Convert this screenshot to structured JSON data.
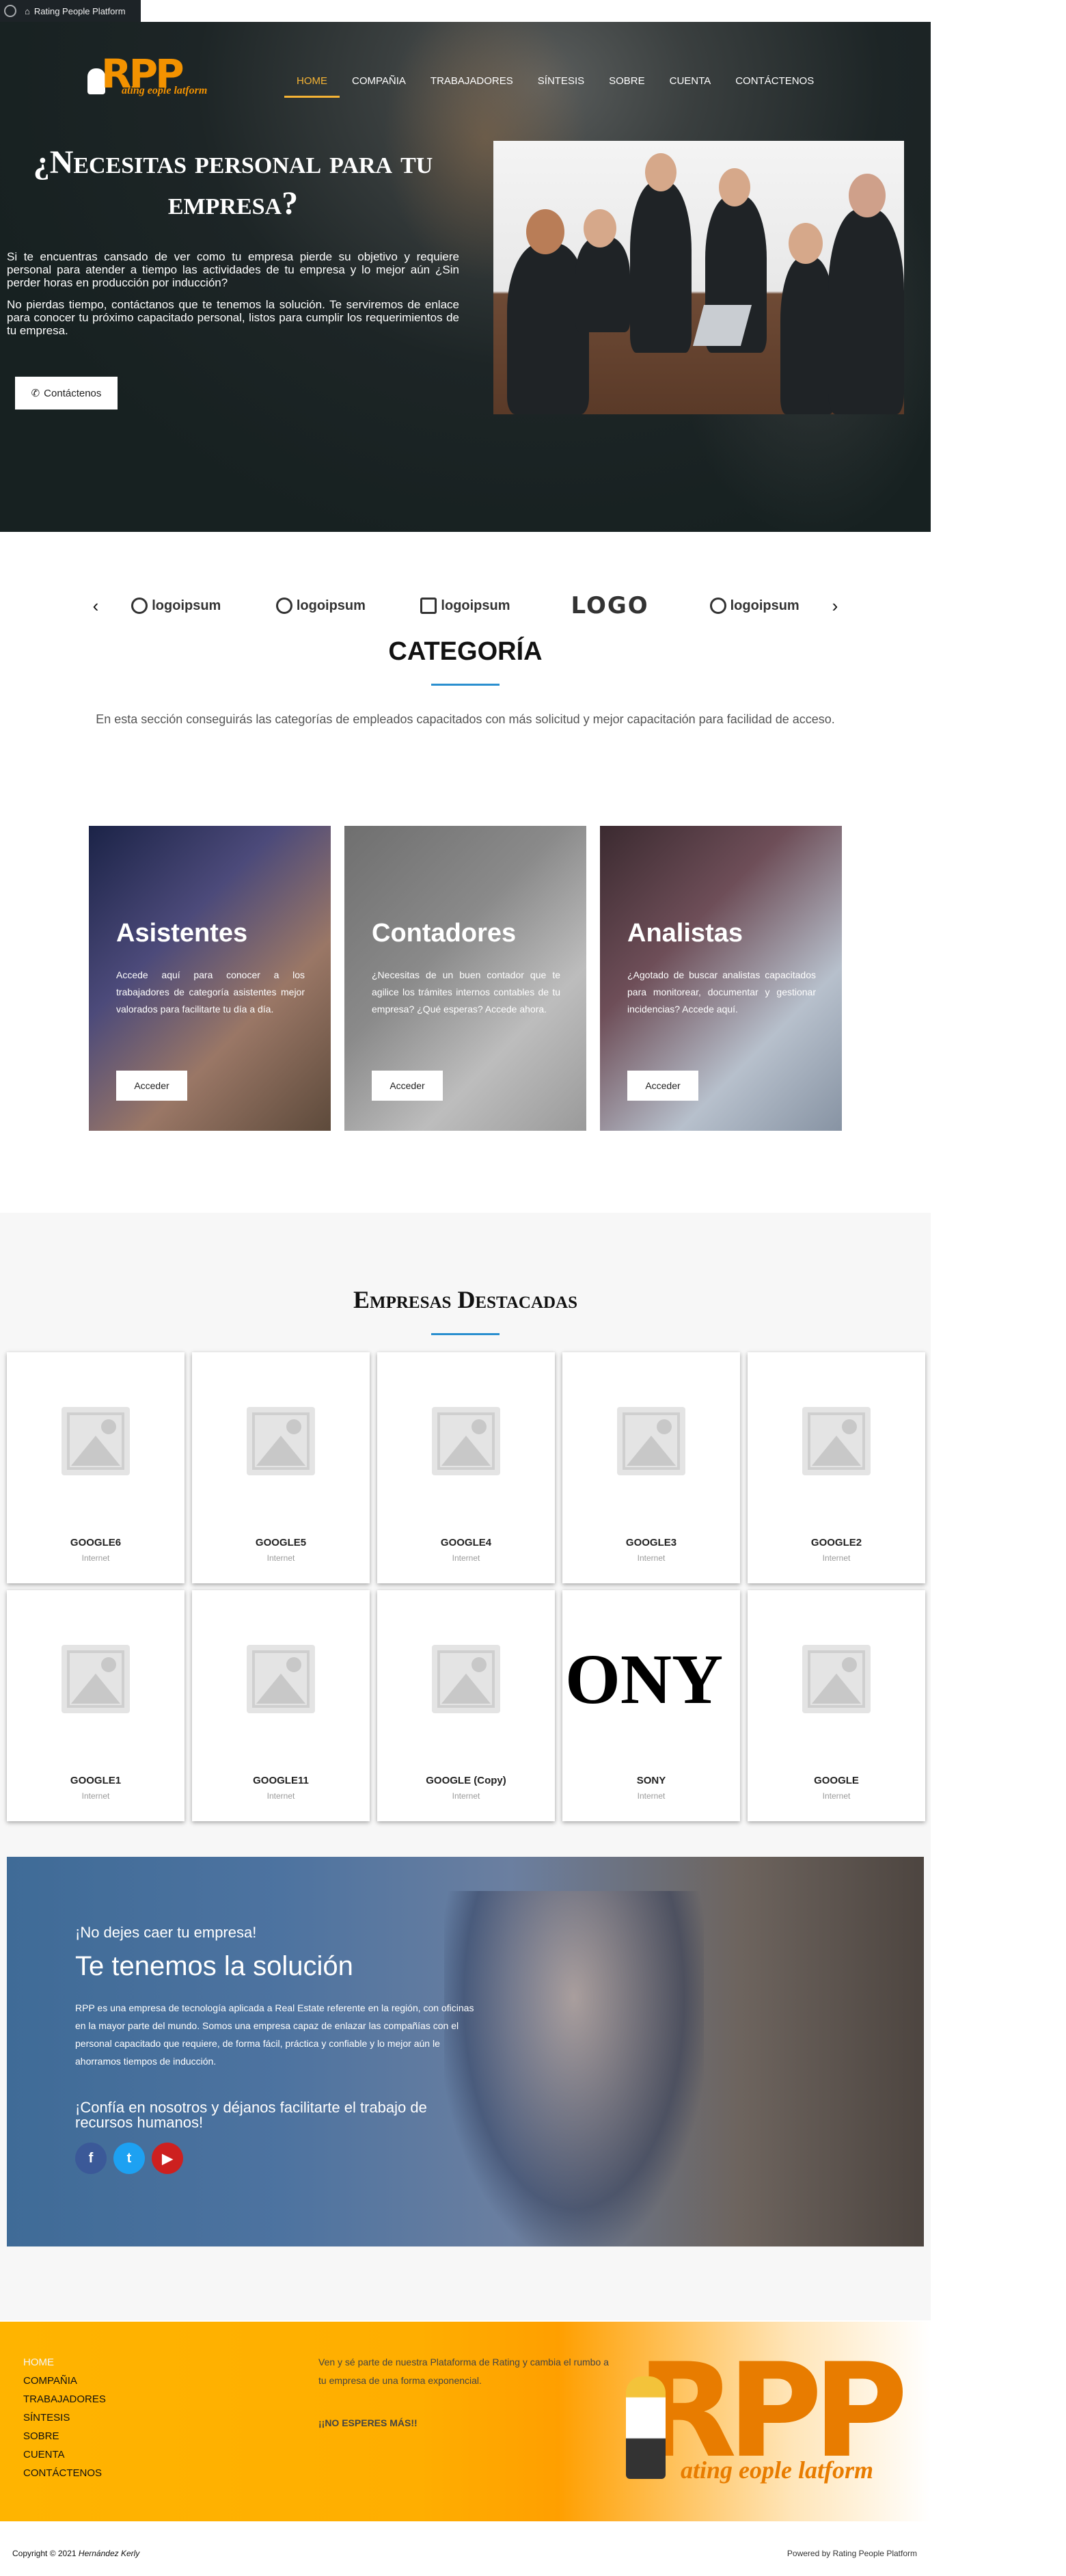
{
  "admin_bar": {
    "site_name": "Rating People Platform"
  },
  "header": {
    "logo": {
      "big": "RPP",
      "small": "ating eople latform"
    },
    "nav": [
      {
        "label": "HOME",
        "active": true
      },
      {
        "label": "COMPAÑIA",
        "active": false
      },
      {
        "label": "TRABAJADORES",
        "active": false
      },
      {
        "label": "SÍNTESIS",
        "active": false
      },
      {
        "label": "SOBRE",
        "active": false
      },
      {
        "label": "CUENTA",
        "active": false
      },
      {
        "label": "CONTÁCTENOS",
        "active": false
      }
    ]
  },
  "hero": {
    "title": "¿Necesitas personal para tu empresa?",
    "paragraph1": "Si te encuentras cansado de ver como tu empresa pierde su objetivo y requiere personal para atender a tiempo las actividades de tu empresa y lo mejor aún ¿Sin perder horas en producción por inducción?",
    "paragraph2": "No pierdas tiempo, contáctanos que te tenemos la solución. Te serviremos de enlace para conocer tu próximo capacitado personal, listos para cumplir los requerimientos de tu empresa.",
    "button_label": "Contáctenos"
  },
  "logos": [
    "logoipsum",
    "logoipsum",
    "logoipsum",
    "LOGO",
    "logoipsum"
  ],
  "category": {
    "title": "CATEGORÍA",
    "description": "En esta sección conseguirás las categorías de empleados capacitados con más solicitud y mejor capacitación para facilidad de acceso.",
    "cards": [
      {
        "title": "Asistentes",
        "text": "Accede aquí para conocer a los trabajadores de categoría asistentes mejor valorados para facilitarte tu día a día.",
        "button": "Acceder"
      },
      {
        "title": "Contadores",
        "text": "¿Necesitas de un buen contador que te agilice los trámites internos contables de tu empresa? ¿Qué esperas? Accede ahora.",
        "button": "Acceder"
      },
      {
        "title": "Analistas",
        "text": "¿Agotado de buscar analistas capacitados para monitorear, documentar y gestionar incidencias? Accede aquí.",
        "button": "Acceder"
      }
    ]
  },
  "featured": {
    "title": "Empresas Destacadas",
    "companies": [
      {
        "name": "GOOGLE6",
        "category": "Internet",
        "image": "placeholder"
      },
      {
        "name": "GOOGLE5",
        "category": "Internet",
        "image": "placeholder"
      },
      {
        "name": "GOOGLE4",
        "category": "Internet",
        "image": "placeholder"
      },
      {
        "name": "GOOGLE3",
        "category": "Internet",
        "image": "placeholder"
      },
      {
        "name": "GOOGLE2",
        "category": "Internet",
        "image": "placeholder"
      },
      {
        "name": "GOOGLE1",
        "category": "Internet",
        "image": "placeholder"
      },
      {
        "name": "GOOGLE11",
        "category": "Internet",
        "image": "placeholder"
      },
      {
        "name": "GOOGLE (Copy)",
        "category": "Internet",
        "image": "placeholder"
      },
      {
        "name": "SONY",
        "category": "Internet",
        "image": "sony-logo",
        "logo_text": "ONY"
      },
      {
        "name": "GOOGLE",
        "category": "Internet",
        "image": "placeholder"
      }
    ]
  },
  "banner": {
    "kicker": "¡No dejes caer tu empresa!",
    "title": "Te tenemos la solución",
    "text": "RPP es una empresa de tecnología aplicada a Real Estate referente en la región, con oficinas en la mayor parte del mundo. Somos una empresa capaz de enlazar las compañías con el personal capacitado que requiere, de forma fácil, práctica y confiable y lo mejor aún le ahorramos tiempos de inducción.",
    "cta": "¡Confía en nosotros y déjanos facilitarte el trabajo de recursos humanos!",
    "socials": [
      {
        "icon": "facebook-icon",
        "glyph": "f",
        "color": "#3b5998"
      },
      {
        "icon": "twitter-icon",
        "glyph": "t",
        "color": "#1da1f2"
      },
      {
        "icon": "youtube-icon",
        "glyph": "▶",
        "color": "#cd201f"
      }
    ]
  },
  "footer": {
    "nav": [
      "HOME",
      "COMPAÑIA",
      "TRABAJADORES",
      "SÍNTESIS",
      "SOBRE",
      "CUENTA",
      "CONTÁCTENOS"
    ],
    "text": "Ven y sé parte de nuestra Plataforma de Rating y cambia el rumbo a tu empresa de una forma exponencial.",
    "cta": "¡¡NO ESPERES MÁS!!",
    "logo": {
      "big": "RPP",
      "small": "ating eople latform"
    },
    "copyright_prefix": "Copyright © 2021",
    "copyright_author": "Hernández Kerly",
    "powered": "Powered by Rating People Platform"
  },
  "colors": {
    "accent": "#f5b335",
    "brand_orange": "#f39200",
    "link_blue": "#2a8fcf"
  }
}
